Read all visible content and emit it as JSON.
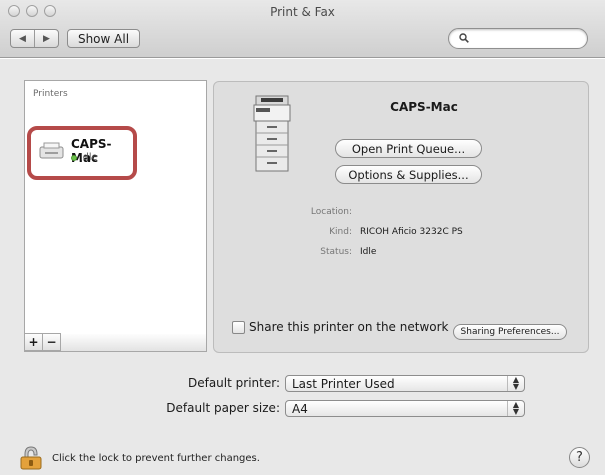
{
  "window": {
    "title": "Print & Fax",
    "show_all_label": "Show All",
    "back_glyph": "◀",
    "forward_glyph": "▶",
    "search_placeholder": ""
  },
  "printers": {
    "header": "Printers",
    "items": [
      {
        "name": "CAPS-Mac",
        "status": "Idle",
        "status_color": "#6cc24a",
        "selected_highlight": "#b54a49"
      }
    ],
    "add_label": "+",
    "remove_label": "−"
  },
  "detail": {
    "printer_name": "CAPS-Mac",
    "open_queue_label": "Open Print Queue...",
    "options_label": "Options & Supplies...",
    "info": [
      {
        "key": "Location:",
        "value": ""
      },
      {
        "key": "Kind:",
        "value": "RICOH Aficio 3232C PS"
      },
      {
        "key": "Status:",
        "value": "Idle"
      }
    ],
    "share_label": "Share this printer on the network",
    "share_checked": false,
    "sharing_prefs_label": "Sharing Preferences..."
  },
  "defaults": {
    "printer_label": "Default printer:",
    "printer_value": "Last Printer Used",
    "paper_label": "Default paper size:",
    "paper_value": "A4"
  },
  "footer": {
    "lock_text": "Click the lock to prevent further changes.",
    "help_label": "?"
  }
}
